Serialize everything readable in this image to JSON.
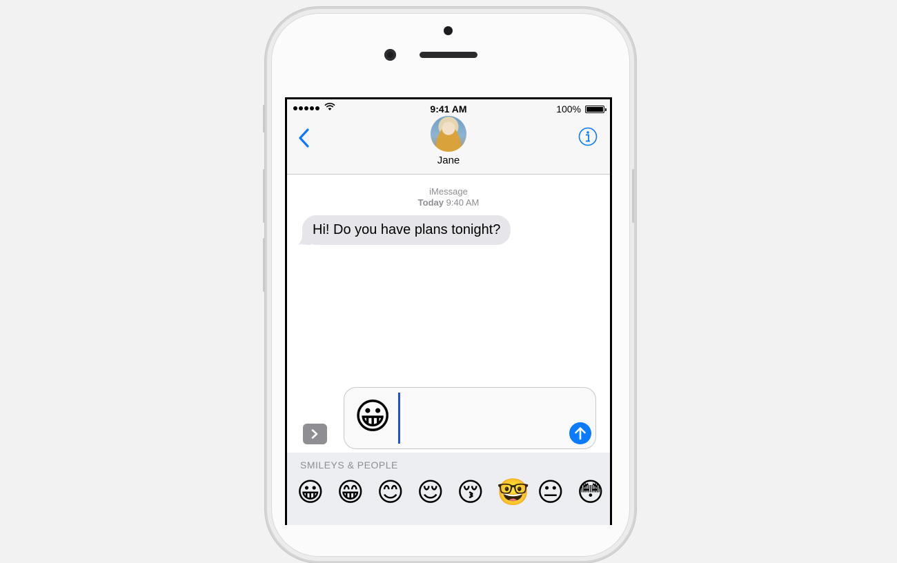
{
  "status_bar": {
    "time": "9:41 AM",
    "battery": "100%"
  },
  "conversation": {
    "contact_name": "Jane",
    "service": "iMessage",
    "date_label": "Today",
    "time_label": "9:40 AM"
  },
  "messages": [
    {
      "from": "Jane",
      "text": "Hi! Do you have plans tonight?"
    }
  ],
  "composer": {
    "value": "😀"
  },
  "emoji_keyboard": {
    "category": "SMILEYS & PEOPLE",
    "row": [
      "😀",
      "😁",
      "😊",
      "😌",
      "😚",
      "🤓",
      "😐",
      "😳"
    ]
  },
  "colors": {
    "accent": "#0a7aff",
    "bubble": "#e5e5ea",
    "caret": "#1d4fe0"
  },
  "icons": [
    "back-chevron-icon",
    "info-icon",
    "expand-chevron-icon",
    "send-arrow-icon",
    "wifi-icon",
    "battery-icon",
    "signal-dots-icon"
  ]
}
